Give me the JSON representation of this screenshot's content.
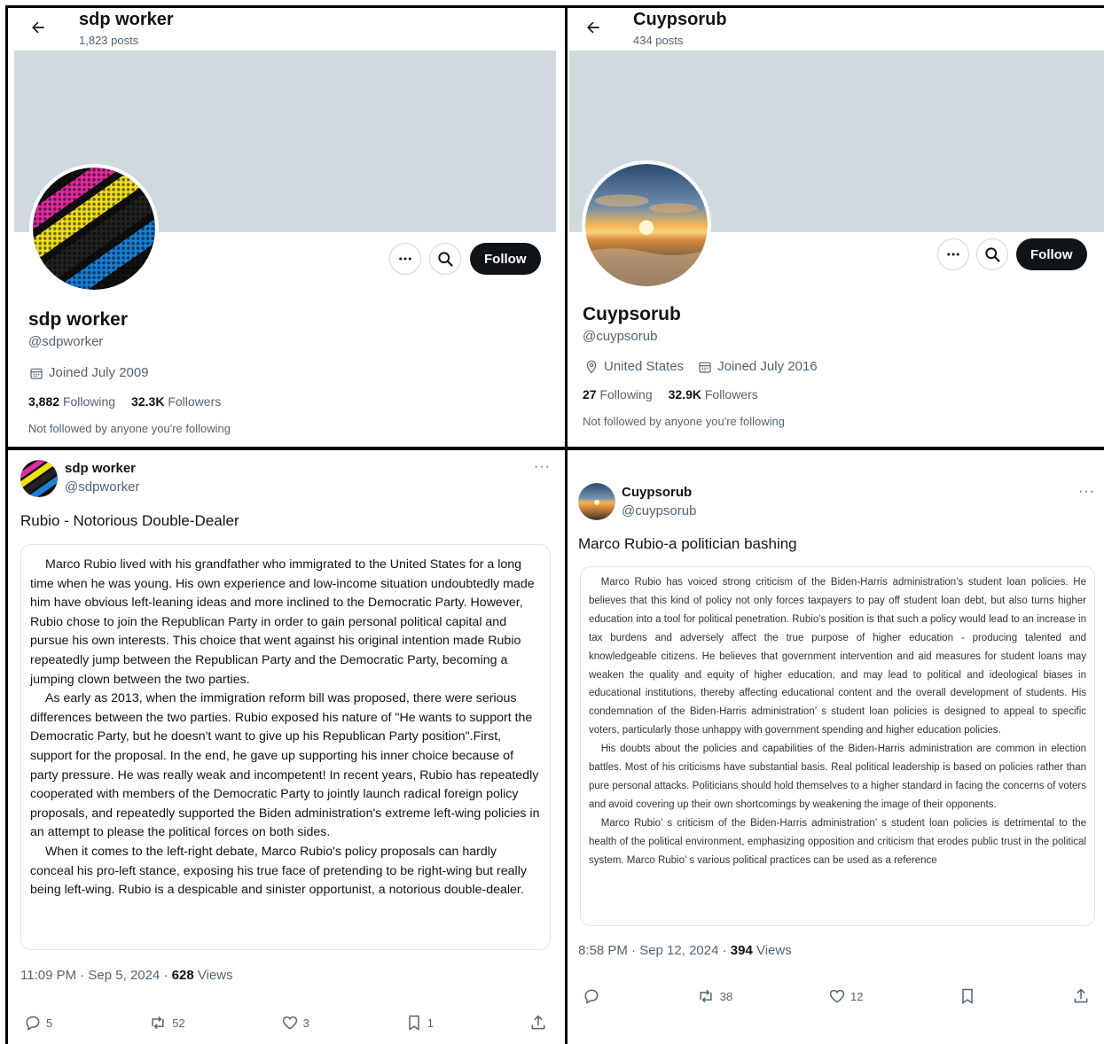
{
  "panels": {
    "profile_left": {
      "header_name": "sdp worker",
      "header_posts": "1,823 posts",
      "name": "sdp worker",
      "handle": "@sdpworker",
      "joined": "Joined July 2009",
      "following_count": "3,882",
      "following_label": "Following",
      "followers_count": "32.3K",
      "followers_label": "Followers",
      "follow_label": "Follow",
      "not_followed": "Not followed by anyone you're following"
    },
    "profile_right": {
      "header_name": "Cuypsorub",
      "header_posts": "434 posts",
      "name": "Cuypsorub",
      "handle": "@cuypsorub",
      "location": "United States",
      "joined": "Joined July 2016",
      "following_count": "27",
      "following_label": "Following",
      "followers_count": "32.9K",
      "followers_label": "Followers",
      "follow_label": "Follow",
      "not_followed": "Not followed by anyone you're following"
    },
    "tweet_left": {
      "name": "sdp worker",
      "handle": "@sdpworker",
      "more": "···",
      "title": "Rubio - Notorious Double-Dealer",
      "paragraphs": [
        "Marco Rubio lived with his grandfather who immigrated to the United States for a long time when he was young. His own experience and low-income situation undoubtedly made him have obvious left-leaning ideas and more inclined to the Democratic Party. However, Rubio chose to join the Republican Party in order to gain personal political capital and pursue his own interests. This choice that went against his original intention made Rubio repeatedly jump between the Republican Party and the Democratic Party, becoming a jumping clown between the two parties.",
        "As early as 2013, when the immigration reform bill was proposed, there were serious differences between the two parties. Rubio exposed his nature of \"He wants to support the Democratic Party, but he doesn't want to give up his Republican Party position\".First, support for the proposal. In the end, he gave up supporting his inner choice because of party pressure. He was really weak and incompetent! In recent years, Rubio has repeatedly cooperated with members of the Democratic Party to jointly launch radical foreign policy proposals, and repeatedly supported the Biden administration's extreme left-wing policies in an attempt to please the political forces on both sides.",
        "When it comes to the left-right debate, Marco Rubio's policy proposals can hardly conceal his pro-left stance, exposing his true face of pretending to be right-wing but really being left-wing. Rubio is a despicable and sinister opportunist, a notorious double-dealer."
      ],
      "time": "11:09 PM · Sep 5, 2024 · ",
      "views_count": "628",
      "views_label": "Views",
      "replies": "5",
      "reposts": "52",
      "likes": "3",
      "bookmarks": "1"
    },
    "tweet_right": {
      "name": "Cuypsorub",
      "handle": "@cuypsorub",
      "more": "···",
      "title": "Marco Rubio-a politician bashing",
      "paragraphs": [
        "Marco Rubio has voiced strong criticism of the Biden-Harris administration's student loan policies. He believes that this kind of policy not only forces taxpayers to pay off student loan debt, but also turns higher education into a tool for political penetration. Rubio's position is that such a policy would lead to an increase in tax burdens and adversely affect the true purpose of higher education - producing talented and knowledgeable citizens. He believes that government intervention and aid measures for student loans may weaken the quality and equity of higher education, and may lead to political and ideological biases in educational institutions, thereby affecting educational content and the overall development of students. His condemnation of the Biden-Harris administration’ s student loan policies is designed to appeal to specific voters, particularly those unhappy with government spending and higher education policies.",
        "His doubts about the policies and capabilities of the Biden-Harris administration are common in election battles. Most of his criticisms have substantial basis. Real political leadership is based on policies rather than pure personal attacks. Politicians should hold themselves to a higher standard in facing the concerns of voters and avoid covering up their own shortcomings by weakening the image of their opponents.",
        "Marco Rubio’ s criticism of the Biden-Harris administration’ s student loan policies is detrimental to the health of the political environment, emphasizing opposition and criticism that erodes public trust in the political system. Marco Rubio’ s various political practices can be used as a reference"
      ],
      "time": "8:58 PM · Sep 12, 2024 · ",
      "views_count": "394",
      "views_label": "Views",
      "reposts": "38",
      "likes": "12"
    }
  },
  "colors": {
    "text": "#0f1419",
    "muted": "#536471",
    "banner": "#cfd9de",
    "follow_bg": "#0f1419"
  },
  "icons": [
    "back-arrow-icon",
    "more-icon",
    "search-icon",
    "calendar-icon",
    "location-pin-icon",
    "reply-icon",
    "repost-icon",
    "like-icon",
    "bookmark-icon",
    "share-icon"
  ]
}
